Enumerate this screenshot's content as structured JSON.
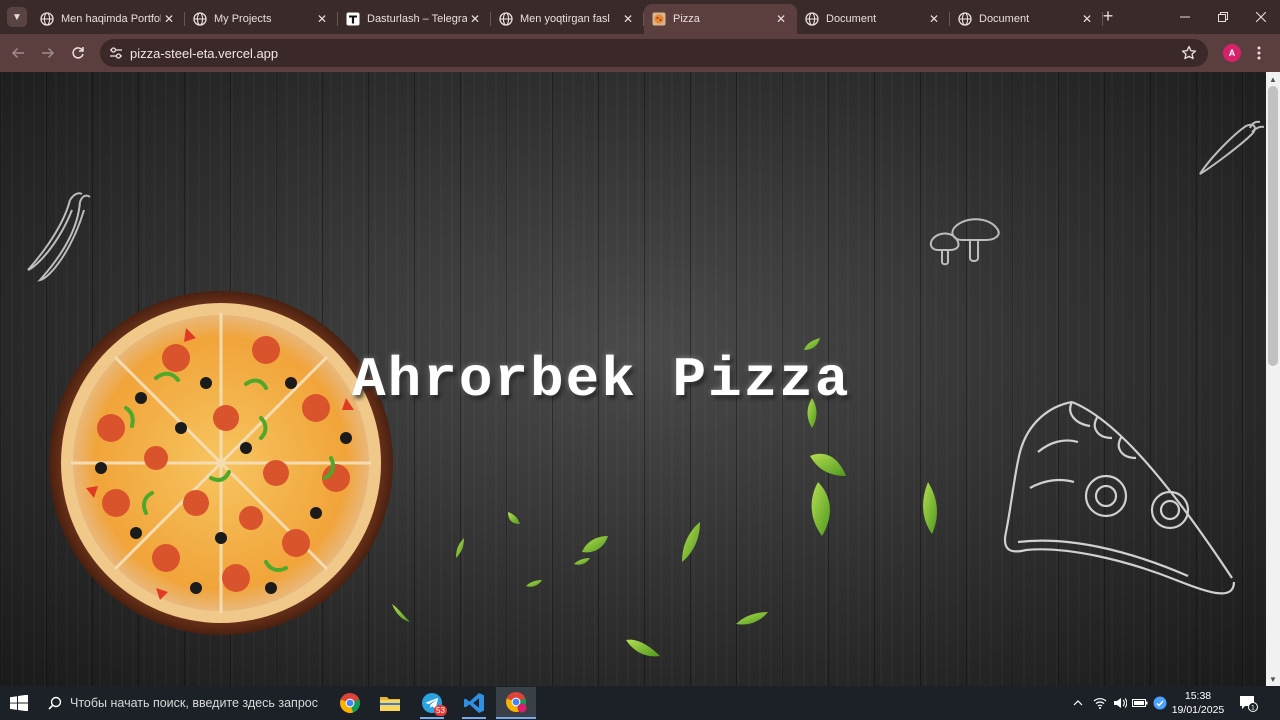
{
  "browser": {
    "tabs": [
      {
        "title": "Men haqimda Portfolio",
        "favicon": "globe-icon",
        "active": false
      },
      {
        "title": "My Projects",
        "favicon": "globe-icon",
        "active": false
      },
      {
        "title": "Dasturlash – Telegraph",
        "favicon": "telegraph-icon",
        "active": false
      },
      {
        "title": "Men yoqtirgan fasl",
        "favicon": "globe-icon",
        "active": false
      },
      {
        "title": "Pizza",
        "favicon": "pizza-icon",
        "active": true
      },
      {
        "title": "Document",
        "favicon": "globe-icon",
        "active": false
      },
      {
        "title": "Document",
        "favicon": "globe-icon",
        "active": false
      }
    ],
    "close_symbol": "✕",
    "new_tab_symbol": "+",
    "url": "pizza-steel-eta.vercel.app",
    "profile_initial": "A",
    "accent": "#5b3f3f"
  },
  "page": {
    "hero_title": "Ahrorbek Pizza"
  },
  "taskbar": {
    "search_placeholder": "Чтобы начать поиск, введите здесь запрос",
    "telegram_badge": "53",
    "time": "15:38",
    "date": "19/01/2025"
  }
}
